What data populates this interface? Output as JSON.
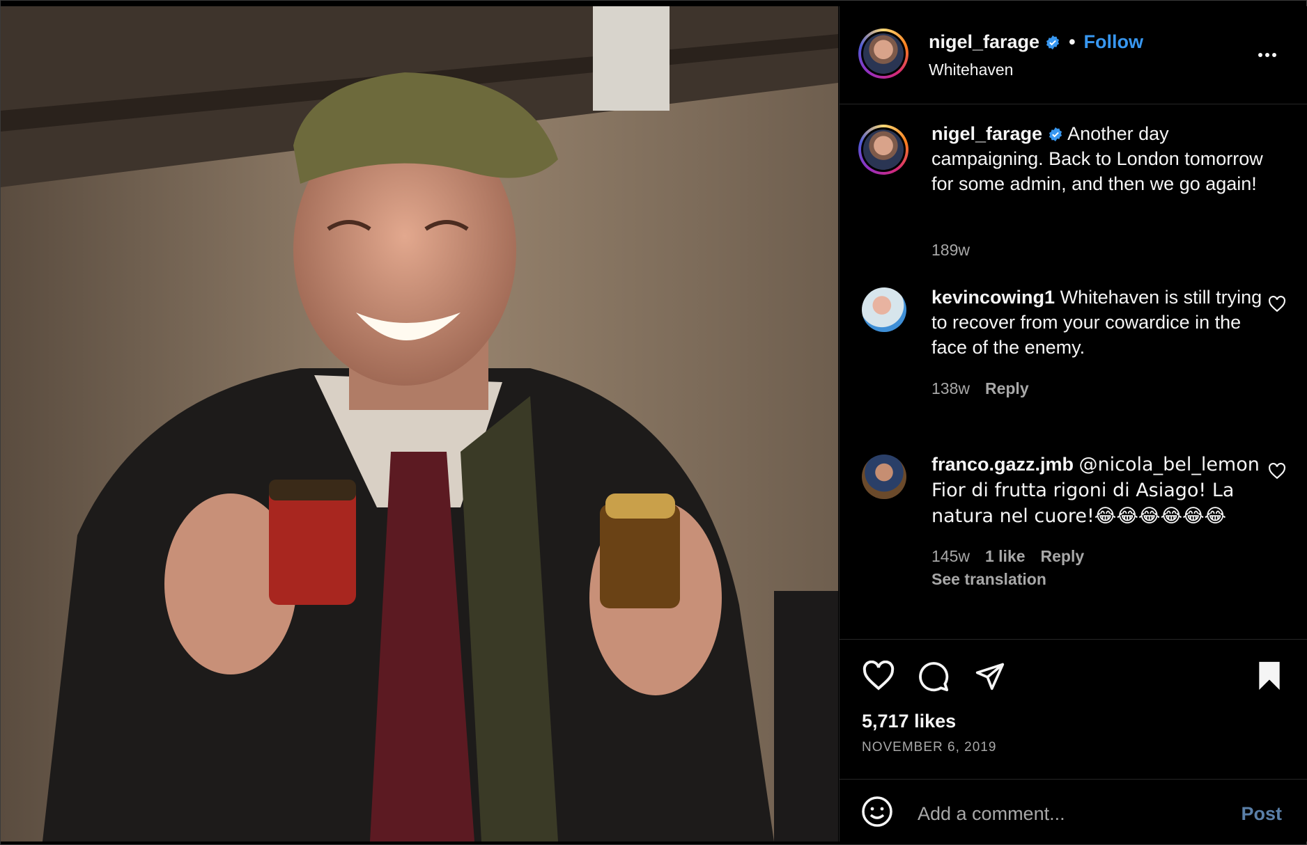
{
  "post": {
    "username": "nigel_farage",
    "follow_label": "Follow",
    "dot": "•",
    "location": "Whitehaven",
    "caption": "Another day campaigning. Back to London tomorrow for some admin, and then we go again!",
    "caption_age": "189w"
  },
  "comments": [
    {
      "username": "kevincowing1",
      "text": "Whitehaven is still trying to recover from your cowardice in the face of the enemy.",
      "age": "138w",
      "reply_label": "Reply"
    },
    {
      "username": "franco.gazz.jmb",
      "text": "@nicola_bel_lemon Fior di frutta rigoni di Asiago! La natura nel cuore!😂😂😂😂😂😂",
      "age": "145w",
      "likes_label": "1 like",
      "reply_label": "Reply",
      "translate_label": "See translation"
    }
  ],
  "engagement": {
    "likes": "5,717 likes",
    "date": "NOVEMBER 6, 2019"
  },
  "composer": {
    "placeholder": "Add a comment...",
    "post_label": "Post"
  },
  "colors": {
    "accent": "#3897f0",
    "muted": "#a8a8a8",
    "post_disabled": "#5a7fa8"
  },
  "icons": [
    "more-options-icon",
    "verified-badge-icon",
    "heart-icon",
    "comment-icon",
    "share-icon",
    "bookmark-icon",
    "emoji-icon"
  ]
}
